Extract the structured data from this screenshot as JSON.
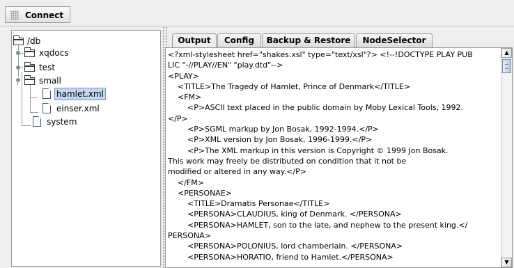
{
  "toolbar": {
    "connect_label": "Connect"
  },
  "tree": {
    "nodes": [
      {
        "label": "/db",
        "icon": "folder-icon",
        "handle": "none"
      },
      {
        "label": "xqdocs",
        "icon": "folder-icon",
        "handle": "collapsed"
      },
      {
        "label": "test",
        "icon": "folder-icon",
        "handle": "collapsed"
      },
      {
        "label": "small",
        "icon": "folder-icon",
        "handle": "expanded"
      },
      {
        "label": "hamlet.xml",
        "icon": "document-icon",
        "selected": true
      },
      {
        "label": "einser.xml",
        "icon": "document-icon"
      },
      {
        "label": "system",
        "icon": "document-icon"
      }
    ]
  },
  "tabs": [
    {
      "label": "Output",
      "active": true
    },
    {
      "label": "Config"
    },
    {
      "label": "Backup & Restore"
    },
    {
      "label": "NodeSelector"
    }
  ],
  "output": {
    "lines": [
      "<?xml-stylesheet href=\"shakes.xsl\" type=\"text/xsl\"?> <!--!DOCTYPE PLAY PUB",
      "LIC \"-//PLAY//EN\" \"play.dtd\"-->",
      "<PLAY>",
      "    <TITLE>The Tragedy of Hamlet, Prince of Denmark</TITLE>",
      "    <FM>",
      "        <P>ASCII text placed in the public domain by Moby Lexical Tools, 1992.",
      "</P>",
      "        <P>SGML markup by Jon Bosak, 1992-1994.</P>",
      "        <P>XML version by Jon Bosak, 1996-1999.</P>",
      "        <P>The XML markup in this version is Copyright © 1999 Jon Bosak.",
      "This work may freely be distributed on condition that it not be",
      "modified or altered in any way.</P>",
      "    </FM>",
      "    <PERSONAE>",
      "        <TITLE>Dramatis Personae</TITLE>",
      "        <PERSONA>CLAUDIUS, king of Denmark. </PERSONA>",
      "        <PERSONA>HAMLET, son to the late, and nephew to the present king.</",
      "PERSONA>",
      "        <PERSONA>POLONIUS, lord chamberlain. </PERSONA>",
      "        <PERSONA>HORATIO, friend to Hamlet.</PERSONA>"
    ]
  },
  "scrollbar": {
    "up_arrow": "▲",
    "down_arrow": "▼"
  }
}
